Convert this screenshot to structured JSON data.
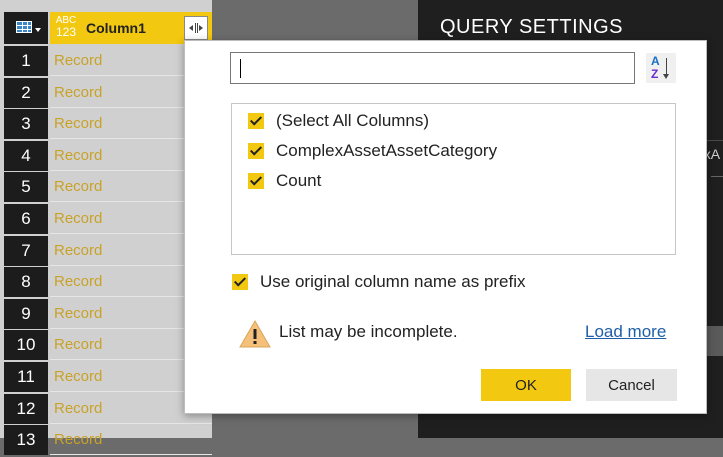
{
  "grid": {
    "column_type_top": "ABC",
    "column_type_bottom": "123",
    "column_name": "Column1",
    "rows": [
      {
        "num": "1",
        "value": "Record"
      },
      {
        "num": "2",
        "value": "Record"
      },
      {
        "num": "3",
        "value": "Record"
      },
      {
        "num": "4",
        "value": "Record"
      },
      {
        "num": "5",
        "value": "Record"
      },
      {
        "num": "6",
        "value": "Record"
      },
      {
        "num": "7",
        "value": "Record"
      },
      {
        "num": "8",
        "value": "Record"
      },
      {
        "num": "9",
        "value": "Record"
      },
      {
        "num": "10",
        "value": "Record"
      },
      {
        "num": "11",
        "value": "Record"
      },
      {
        "num": "12",
        "value": "Record"
      },
      {
        "num": "13",
        "value": "Record"
      }
    ]
  },
  "side_panel": {
    "title": "QUERY SETTINGS",
    "snippet": "exA"
  },
  "dialog": {
    "search_value": "",
    "sort_icon": "sort-a-z-icon",
    "columns": [
      {
        "label": "(Select All Columns)",
        "checked": true
      },
      {
        "label": "ComplexAssetAssetCategory",
        "checked": true
      },
      {
        "label": "Count",
        "checked": true
      }
    ],
    "prefix_label": "Use original column name as prefix",
    "prefix_checked": true,
    "warning_text": "List may be incomplete.",
    "load_more": "Load more",
    "ok_label": "OK",
    "cancel_label": "Cancel"
  },
  "colors": {
    "accent": "#f2c811",
    "record_text": "#c9a227",
    "link": "#1f5fa8",
    "panel_bg": "#1f1f1f"
  }
}
